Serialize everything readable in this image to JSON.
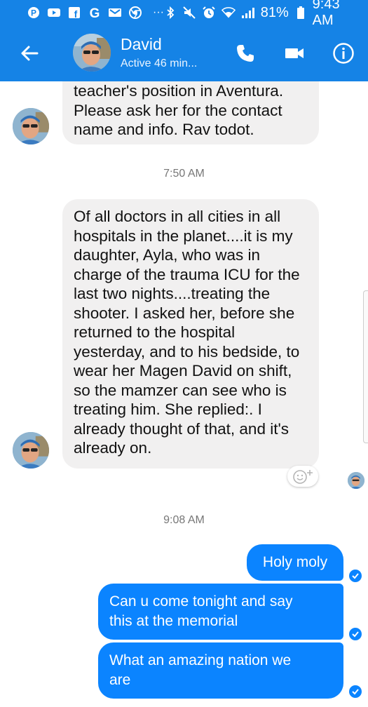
{
  "status_bar": {
    "notification_icons": [
      "pinterest-icon",
      "youtube-icon",
      "facebook-icon",
      "google-icon",
      "gmail-icon",
      "chrome-icon"
    ],
    "more": "···",
    "battery": "81%",
    "time": "9:43 AM"
  },
  "header": {
    "contact_name": "David",
    "status": "Active 46 min...",
    "actions": [
      "phone-icon",
      "video-icon",
      "info-icon"
    ]
  },
  "messages": {
    "first": {
      "lines": [
        "teacher's position in Aventura.",
        "Please ask her for the contact",
        "name and info.  Rav todot."
      ]
    },
    "stamp1": "7:50 AM",
    "second": {
      "lines": [
        "Of all doctors in all cities in all",
        "hospitals in the planet....it is my",
        "daughter, Ayla, who was in",
        "charge of the trauma ICU for the",
        "last two nights....treating the",
        "shooter.  I asked her, before she",
        "returned to the hospital",
        "yesterday, and to his bedside, to",
        "wear her Magen David on shift,",
        "so the mamzer can see who is",
        "treating him.  She replied:. I",
        "already thought of that, and it's",
        "already on."
      ]
    },
    "stamp2": "9:08 AM",
    "out1": "Holy moly",
    "out2": {
      "lines": [
        "Can u come tonight and say",
        "this at the memorial"
      ]
    },
    "out3": {
      "lines": [
        "What an amazing nation we",
        "are"
      ]
    }
  },
  "colors": {
    "header": "#1583e6",
    "outgoing_bubble": "#0b84ff",
    "incoming_bubble": "#f1f0f0"
  }
}
